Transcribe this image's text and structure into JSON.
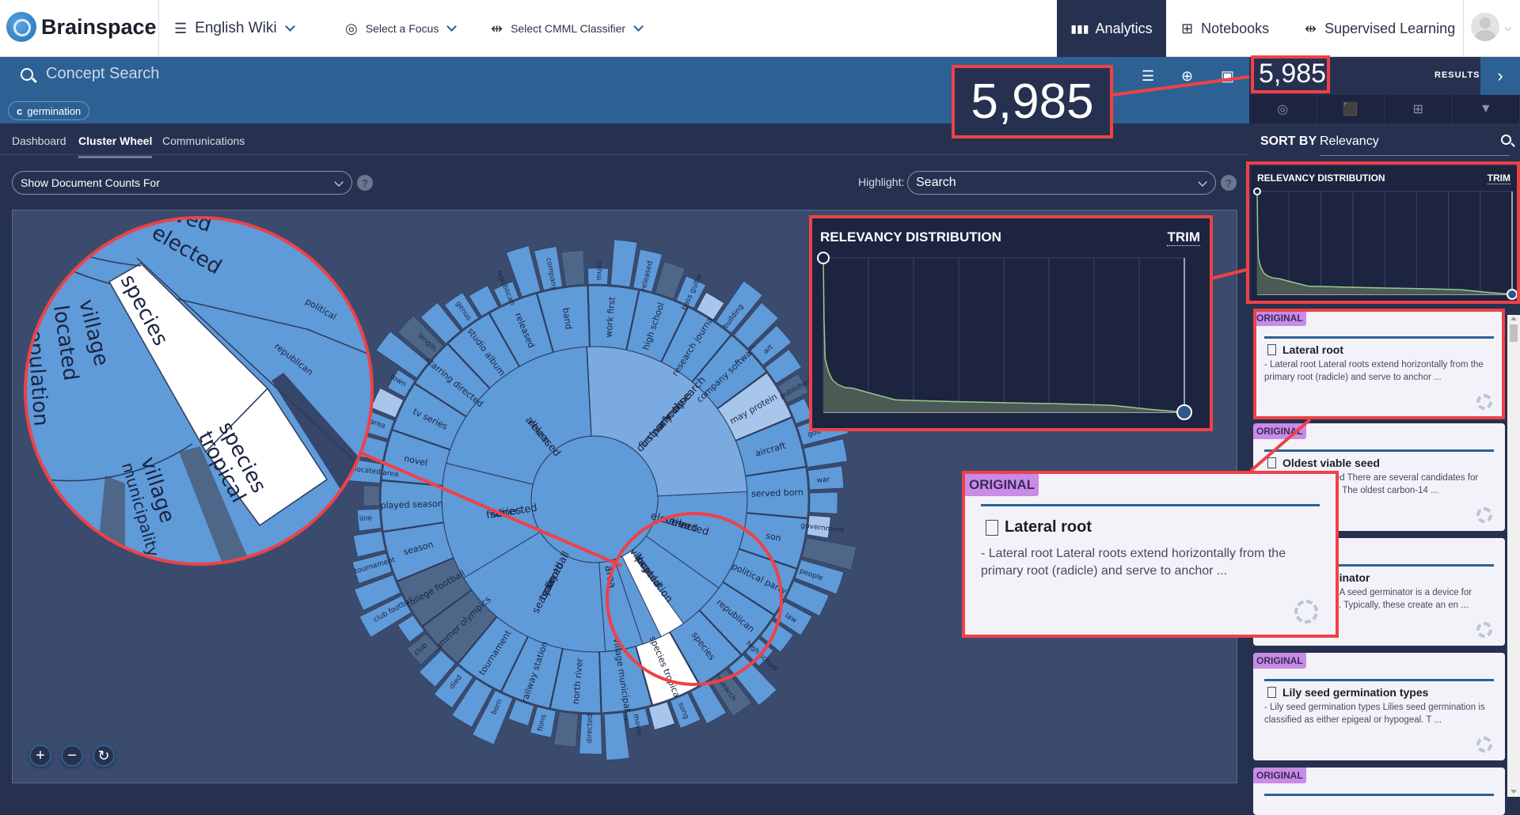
{
  "app": {
    "brand": "Brainspace",
    "dataset": "English Wiki",
    "focus_label": "Select a Focus",
    "classifier_label": "Select CMML Classifier",
    "nav_tabs": [
      {
        "label": "Analytics",
        "icon": "bar-chart-icon",
        "active": true
      },
      {
        "label": "Notebooks",
        "icon": "grid-icon",
        "active": false
      },
      {
        "label": "Supervised Learning",
        "icon": "fork-icon",
        "active": false
      }
    ]
  },
  "search": {
    "placeholder": "Concept Search",
    "chips": [
      {
        "type": "c",
        "label": "germination"
      }
    ],
    "icons": [
      "filter-icon",
      "target-icon",
      "save-icon"
    ],
    "clear_icon": "close-icon"
  },
  "results": {
    "count": "5,985",
    "label": "RESULTS",
    "tools": [
      "focus-icon",
      "tag-icon",
      "add-document-icon",
      "archive-icon"
    ],
    "sort_by_label": "SORT BY",
    "sort_by_value": "Relevancy"
  },
  "tabs": [
    {
      "label": "Dashboard",
      "active": false
    },
    {
      "label": "Cluster Wheel",
      "active": true
    },
    {
      "label": "Communications",
      "active": false
    }
  ],
  "controls": {
    "doc_counts_select": "Show Document Counts For",
    "highlight_label": "Highlight:",
    "highlight_value": "Search",
    "help": "?"
  },
  "zoom_controls": {
    "zoom_in": "+",
    "zoom_out": "−",
    "reset": "↻"
  },
  "relevancy": {
    "title": "RELEVANCY DISTRIBUTION",
    "trim": "TRIM"
  },
  "chart_data": {
    "type": "area",
    "title": "RELEVANCY DISTRIBUTION",
    "xlabel": "",
    "ylabel": "",
    "x": [
      0,
      0.2,
      0.5,
      1,
      1.5,
      2.5,
      4,
      6,
      8.3,
      12,
      20,
      35,
      50,
      65,
      80,
      90,
      100
    ],
    "values": [
      100,
      60,
      35,
      30,
      26,
      21,
      18,
      16,
      15.5,
      13,
      8,
      7,
      6.2,
      5.5,
      4.5,
      2,
      0
    ],
    "xlim": [
      0,
      100
    ],
    "ylim": [
      0,
      100
    ],
    "grid": true,
    "handles": [
      "start",
      "end"
    ]
  },
  "cards": [
    {
      "badge": "ORIGINAL",
      "title": "Lateral root",
      "desc": "- Lateral root Lateral roots extend horizontally from the primary root (radicle) and serve to anchor ..."
    },
    {
      "badge": "ORIGINAL",
      "title": "Oldest viable seed",
      "desc": "- Oldest viable seed There are several candidates for oldest viable seed: The oldest carbon-14 ..."
    },
    {
      "badge": "ORIGINAL",
      "title": "Seed germinator",
      "desc": "- Seed germinator A seed germinator is a device for germinating seeds. Typically, these create an en ..."
    },
    {
      "badge": "ORIGINAL",
      "title": "Lily seed germination types",
      "desc": "- Lily seed germination types Lilies seed germination is classified as either epigeal or hypogeal. T ..."
    },
    {
      "badge": "ORIGINAL",
      "title": "",
      "desc": ""
    }
  ],
  "wheel": {
    "inner": [
      {
        "label": "first company work school may time research",
        "shade": "light"
      },
      {
        "label": "election served elected",
        "shade": "mid"
      },
      {
        "label": "village located population",
        "shade": "mid"
      },
      {
        "label": "area",
        "shade": "mid"
      },
      {
        "label": "football played team season",
        "shade": "mid"
      },
      {
        "label": "directed series film",
        "shade": "mid"
      },
      {
        "label": "released album",
        "shade": "mid"
      }
    ],
    "middle": [
      "work first people published book time art",
      "high school",
      "research journal",
      "company software",
      "may protein",
      "aircraft",
      "served born",
      "son",
      "political party",
      "republican",
      "species",
      "species tropical",
      "village municipality",
      "north river area located",
      "railway station",
      "tournament",
      "summer olympics",
      "college football",
      "season",
      "played season club",
      "novel",
      "tv series",
      "starring directed film",
      "studio album",
      "released",
      "band"
    ],
    "outer": [
      "music",
      "released",
      "bass guitar",
      "building",
      "art",
      "published",
      "god",
      "war",
      "government",
      "people",
      "law",
      "high school",
      "research",
      "song",
      "movie",
      "directed",
      "films",
      "born",
      "died",
      "club",
      "club football",
      "tournament",
      "line",
      "town located area",
      "area",
      "town",
      "length",
      "genus",
      "republican",
      "company"
    ],
    "magnifier_labels": [
      "served",
      "elected",
      "species",
      "village",
      "located",
      "population",
      "species tropical",
      "village municipality",
      "political",
      "republican"
    ]
  }
}
